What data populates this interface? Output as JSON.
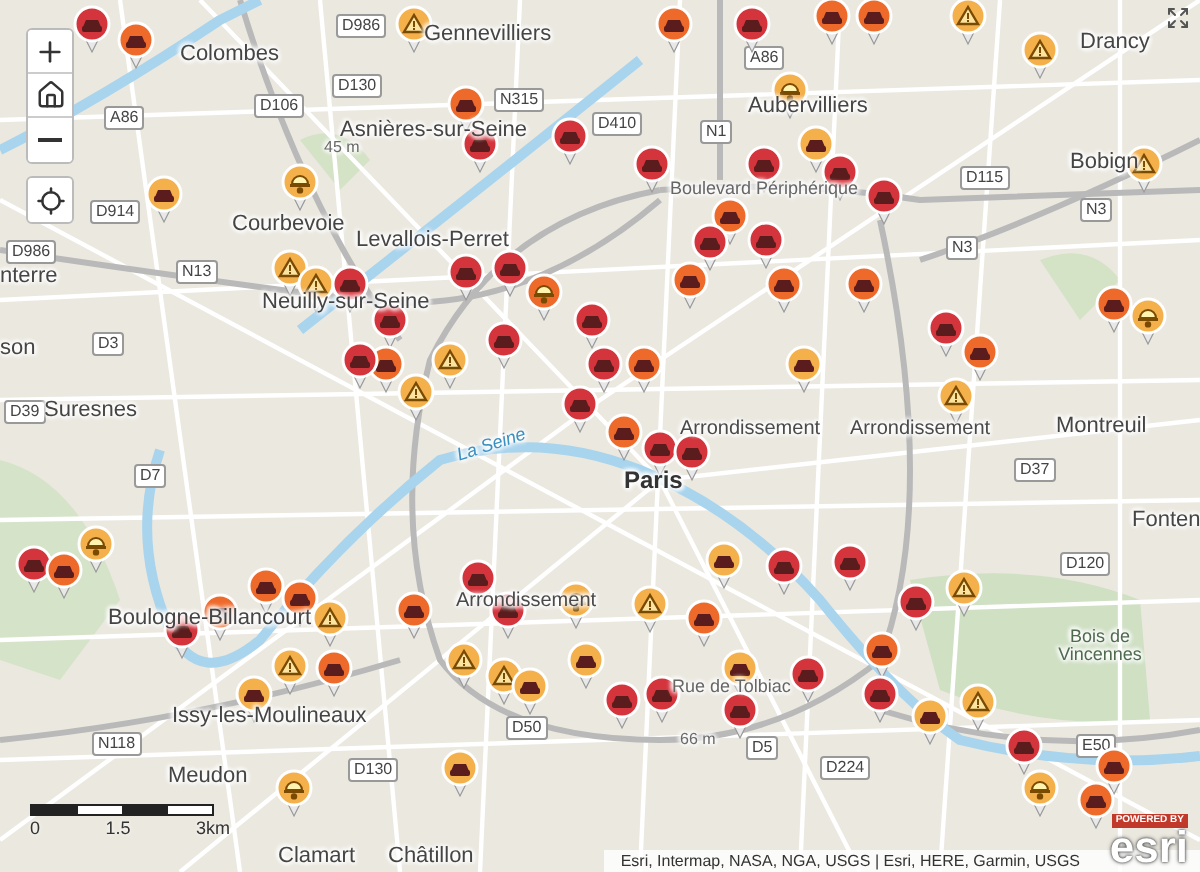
{
  "places": [
    {
      "name": "Colombes",
      "kind": "town"
    },
    {
      "name": "Gennevilliers",
      "kind": "town"
    },
    {
      "name": "Asnières-sur-Seine",
      "kind": "town"
    },
    {
      "name": "45 m",
      "kind": "elevation"
    },
    {
      "name": "Courbevoie",
      "kind": "town"
    },
    {
      "name": "Levallois-Perret",
      "kind": "town"
    },
    {
      "name": "Neuilly-sur-Seine",
      "kind": "town"
    },
    {
      "name": "nterre",
      "kind": "town"
    },
    {
      "name": "son",
      "kind": "town"
    },
    {
      "name": "Suresnes",
      "kind": "town"
    },
    {
      "name": "Drancy",
      "kind": "town"
    },
    {
      "name": "Aubervilliers",
      "kind": "town"
    },
    {
      "name": "Bobign",
      "kind": "town"
    },
    {
      "name": "Boulevard Périphérique",
      "kind": "street"
    },
    {
      "name": "Arrondissement",
      "kind": "district"
    },
    {
      "name": "Arrondissement",
      "kind": "district"
    },
    {
      "name": "Paris",
      "kind": "city"
    },
    {
      "name": "Montreuil",
      "kind": "town"
    },
    {
      "name": "Fonten",
      "kind": "town"
    },
    {
      "name": "La Seine",
      "kind": "water"
    },
    {
      "name": "Boulogne-Billancourt",
      "kind": "town"
    },
    {
      "name": "Arrondissement",
      "kind": "district"
    },
    {
      "name": "Issy-les-Moulineaux",
      "kind": "town"
    },
    {
      "name": "Rue de Tolbiac",
      "kind": "street"
    },
    {
      "name": "66 m",
      "kind": "elevation"
    },
    {
      "name": "Bois de Vincennes",
      "kind": "park"
    },
    {
      "name": "Meudon",
      "kind": "town"
    },
    {
      "name": "Clamart",
      "kind": "town"
    },
    {
      "name": "Châtillon",
      "kind": "town"
    }
  ],
  "roads": [
    "D986",
    "D130",
    "D106",
    "A86",
    "N315",
    "D914",
    "D986",
    "N13",
    "D3",
    "D39",
    "D7",
    "N118",
    "D130",
    "D50",
    "D410",
    "N1",
    "A86",
    "D115",
    "N3",
    "N3",
    "D37",
    "D120",
    "E50",
    "D224",
    "D5"
  ],
  "incidents": [
    {
      "kind": "vehicle",
      "color": "#ee6a2b"
    },
    {
      "kind": "vehicle",
      "color": "#d4343c"
    },
    {
      "kind": "warning",
      "color": "#f4b04a"
    },
    {
      "kind": "vehicle",
      "color": "#ee6a2b"
    },
    {
      "kind": "vehicle",
      "color": "#d4343c"
    },
    {
      "kind": "vehicle",
      "color": "#d4343c"
    },
    {
      "kind": "vehicle",
      "color": "#f4b04a"
    },
    {
      "kind": "roadwork",
      "color": "#f4b04a"
    },
    {
      "kind": "warning",
      "color": "#f4b04a"
    },
    {
      "kind": "warning",
      "color": "#f4b04a"
    },
    {
      "kind": "vehicle",
      "color": "#d4343c"
    },
    {
      "kind": "vehicle",
      "color": "#d4343c"
    },
    {
      "kind": "vehicle",
      "color": "#ee6a2b"
    },
    {
      "kind": "vehicle",
      "color": "#d4343c"
    },
    {
      "kind": "warning",
      "color": "#f4b04a"
    },
    {
      "kind": "warning",
      "color": "#f4b04a"
    },
    {
      "kind": "vehicle",
      "color": "#d4343c"
    },
    {
      "kind": "vehicle",
      "color": "#d4343c"
    },
    {
      "kind": "vehicle",
      "color": "#d4343c"
    },
    {
      "kind": "roadwork",
      "color": "#ee6a2b"
    },
    {
      "kind": "vehicle",
      "color": "#d4343c"
    },
    {
      "kind": "vehicle",
      "color": "#d4343c"
    },
    {
      "kind": "vehicle",
      "color": "#d4343c"
    },
    {
      "kind": "vehicle",
      "color": "#ee6a2b"
    },
    {
      "kind": "vehicle",
      "color": "#d4343c"
    },
    {
      "kind": "vehicle",
      "color": "#ee6a2b"
    },
    {
      "kind": "vehicle",
      "color": "#d4343c"
    },
    {
      "kind": "vehicle",
      "color": "#ee6a2b"
    },
    {
      "kind": "vehicle",
      "color": "#d4343c"
    },
    {
      "kind": "vehicle",
      "color": "#ee6a2b"
    },
    {
      "kind": "vehicle",
      "color": "#ee6a2b"
    },
    {
      "kind": "warning",
      "color": "#f4b04a"
    },
    {
      "kind": "warning",
      "color": "#f4b04a"
    },
    {
      "kind": "roadwork",
      "color": "#f4b04a"
    },
    {
      "kind": "vehicle",
      "color": "#f4b04a"
    },
    {
      "kind": "vehicle",
      "color": "#d4343c"
    },
    {
      "kind": "vehicle",
      "color": "#d4343c"
    },
    {
      "kind": "vehicle",
      "color": "#d4343c"
    },
    {
      "kind": "vehicle",
      "color": "#d4343c"
    },
    {
      "kind": "vehicle",
      "color": "#ee6a2b"
    },
    {
      "kind": "vehicle",
      "color": "#d4343c"
    },
    {
      "kind": "vehicle",
      "color": "#d4343c"
    },
    {
      "kind": "vehicle",
      "color": "#ee6a2b"
    },
    {
      "kind": "vehicle",
      "color": "#ee6a2b"
    },
    {
      "kind": "vehicle",
      "color": "#ee6a2b"
    },
    {
      "kind": "vehicle",
      "color": "#f4b04a"
    },
    {
      "kind": "vehicle",
      "color": "#d4343c"
    },
    {
      "kind": "vehicle",
      "color": "#ee6a2b"
    },
    {
      "kind": "warning",
      "color": "#f4b04a"
    },
    {
      "kind": "vehicle",
      "color": "#ee6a2b"
    },
    {
      "kind": "roadwork",
      "color": "#f4b04a"
    },
    {
      "kind": "warning",
      "color": "#f4b04a"
    },
    {
      "kind": "vehicle",
      "color": "#d4343c"
    },
    {
      "kind": "vehicle",
      "color": "#ee6a2b"
    },
    {
      "kind": "roadwork",
      "color": "#f4b04a"
    },
    {
      "kind": "vehicle",
      "color": "#ee6a2b"
    },
    {
      "kind": "vehicle",
      "color": "#ee6a2b"
    },
    {
      "kind": "vehicle",
      "color": "#ee6a2b"
    },
    {
      "kind": "vehicle",
      "color": "#d4343c"
    },
    {
      "kind": "warning",
      "color": "#f4b04a"
    },
    {
      "kind": "warning",
      "color": "#f4b04a"
    },
    {
      "kind": "vehicle",
      "color": "#ee6a2b"
    },
    {
      "kind": "vehicle",
      "color": "#f4b04a"
    },
    {
      "kind": "roadwork",
      "color": "#f4b04a"
    },
    {
      "kind": "vehicle",
      "color": "#ee6a2b"
    },
    {
      "kind": "vehicle",
      "color": "#d4343c"
    },
    {
      "kind": "vehicle",
      "color": "#d4343c"
    },
    {
      "kind": "warning",
      "color": "#f4b04a"
    },
    {
      "kind": "warning",
      "color": "#f4b04a"
    },
    {
      "kind": "vehicle",
      "color": "#f4b04a"
    },
    {
      "kind": "vehicle",
      "color": "#f4b04a"
    },
    {
      "kind": "vehicle",
      "color": "#f4b04a"
    },
    {
      "kind": "roadwork",
      "color": "#f4b04a"
    },
    {
      "kind": "vehicle",
      "color": "#f4b04a"
    },
    {
      "kind": "vehicle",
      "color": "#d4343c"
    },
    {
      "kind": "vehicle",
      "color": "#d4343c"
    },
    {
      "kind": "vehicle",
      "color": "#ee6a2b"
    },
    {
      "kind": "vehicle",
      "color": "#f4b04a"
    },
    {
      "kind": "warning",
      "color": "#f4b04a"
    },
    {
      "kind": "vehicle",
      "color": "#d4343c"
    },
    {
      "kind": "vehicle",
      "color": "#d4343c"
    },
    {
      "kind": "vehicle",
      "color": "#d4343c"
    },
    {
      "kind": "vehicle",
      "color": "#d4343c"
    },
    {
      "kind": "vehicle",
      "color": "#ee6a2b"
    },
    {
      "kind": "vehicle",
      "color": "#d4343c"
    },
    {
      "kind": "vehicle",
      "color": "#d4343c"
    },
    {
      "kind": "warning",
      "color": "#f4b04a"
    },
    {
      "kind": "vehicle",
      "color": "#f4b04a"
    },
    {
      "kind": "warning",
      "color": "#f4b04a"
    },
    {
      "kind": "vehicle",
      "color": "#d4343c"
    },
    {
      "kind": "roadwork",
      "color": "#f4b04a"
    },
    {
      "kind": "vehicle",
      "color": "#ee6a2b"
    },
    {
      "kind": "vehicle",
      "color": "#ee6a2b"
    }
  ],
  "scale_bar": {
    "labels": [
      "0",
      "1.5",
      "3km"
    ]
  },
  "attribution": "Esri, Intermap, NASA, NGA, USGS | Esri, HERE, Garmin, USGS",
  "logo": {
    "caption": "POWERED BY",
    "brand": "esri"
  }
}
